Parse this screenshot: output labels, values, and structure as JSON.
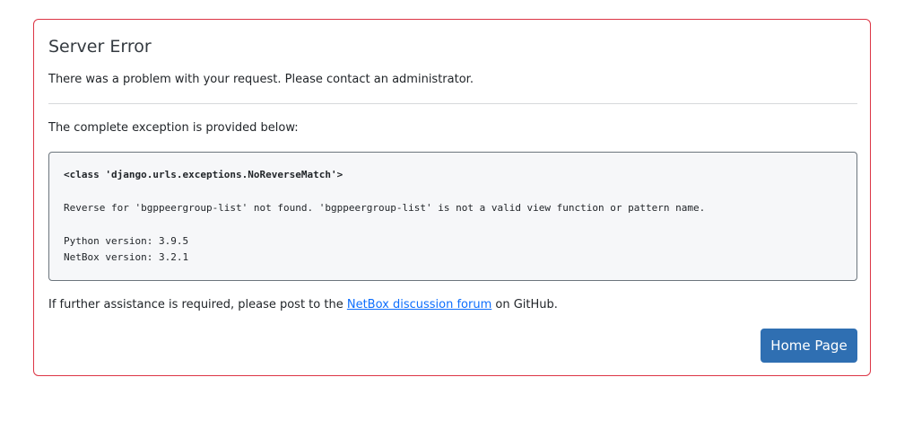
{
  "card": {
    "title": "Server Error",
    "intro": "There was a problem with your request. Please contact an administrator.",
    "exception_intro": "The complete exception is provided below:",
    "exception": {
      "class_line": "<class 'django.urls.exceptions.NoReverseMatch'>",
      "message": "Reverse for 'bgppeergroup-list' not found. 'bgppeergroup-list' is not a valid view function or pattern name.",
      "python_version": "Python version: 3.9.5",
      "netbox_version": "NetBox version: 3.2.1"
    },
    "footer": {
      "prefix": "If further assistance is required, please post to the ",
      "link_text": "NetBox discussion forum",
      "suffix": " on GitHub."
    },
    "home_button_label": "Home Page"
  },
  "colors": {
    "card_border": "#dc3545",
    "link": "#0d6efd",
    "button_bg": "#2f6fb2"
  }
}
